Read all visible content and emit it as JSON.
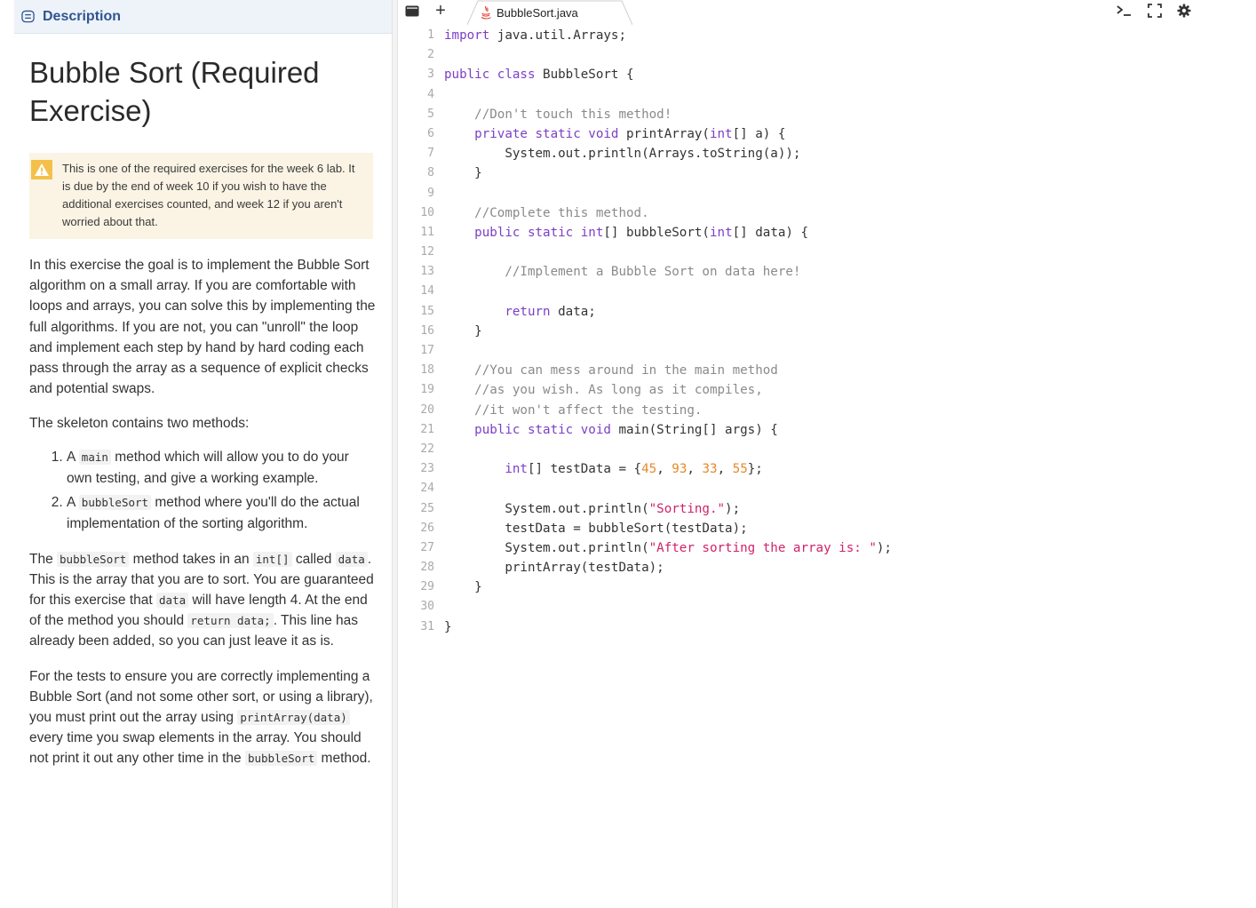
{
  "left": {
    "header_label": "Description",
    "title": "Bubble Sort (Required Exercise)",
    "warning": "This is one of the required exercises for the week 6 lab. It is due by the end of week 10 if you wish to have the additional exercises counted, and week 12 if you aren't worried about that.",
    "p1": "In this exercise the goal is to implement the Bubble Sort algorithm on a small array. If you are comfortable with loops and arrays, you can solve this by implementing the full algorithms. If you are not, you can \"unroll\" the loop and implement each step by hand by hard coding each pass through the array as a sequence of explicit checks and potential swaps.",
    "p2": "The skeleton contains two methods:",
    "list": [
      {
        "pre": "A ",
        "code": "main",
        "post": " method which will allow you to do your own testing, and give a working example."
      },
      {
        "pre": "A ",
        "code": "bubbleSort",
        "post": " method where you'll do the actual implementation of the sorting algorithm."
      }
    ],
    "p3": {
      "t1": "The ",
      "c1": "bubbleSort",
      "t2": " method takes in an ",
      "c2": "int[]",
      "t3": " called ",
      "c3": "data",
      "t4": ". This is the array that you are to sort. You are guaranteed for this exercise that ",
      "c4": "data",
      "t5": " will have length 4. At the end of the method you should ",
      "c5": "return data;",
      "t6": ". This line has already been added, so you can just leave it as is."
    },
    "p4": {
      "t1": "For the tests to ensure you are correctly implementing a Bubble Sort (and not some other sort, or using a library), you must print out the array using ",
      "c1": "printArray(data)",
      "t2": " every time you swap elements in the array. You should not print it out any other time in the ",
      "c2": "bubbleSort",
      "t3": " method."
    }
  },
  "editor": {
    "tab_add": "+",
    "file_tab": "BubbleSort.java",
    "icons": [
      "file-tree-icon",
      "add-icon",
      "java-file-icon",
      "terminal-icon",
      "fullscreen-icon",
      "gear-icon"
    ],
    "code_lines": [
      [
        [
          "kw",
          "import"
        ],
        [
          "p",
          " java.util.Arrays;"
        ]
      ],
      [],
      [
        [
          "kw",
          "public class"
        ],
        [
          "p",
          " BubbleSort {"
        ]
      ],
      [],
      [
        [
          "cm",
          "    //Don't touch this method!"
        ]
      ],
      [
        [
          "p",
          "    "
        ],
        [
          "kw",
          "private static void"
        ],
        [
          "p",
          " printArray("
        ],
        [
          "ty",
          "int"
        ],
        [
          "p",
          "[] a) {"
        ]
      ],
      [
        [
          "p",
          "        System.out.println(Arrays.toString(a));"
        ]
      ],
      [
        [
          "p",
          "    }"
        ]
      ],
      [],
      [
        [
          "cm",
          "    //Complete this method."
        ]
      ],
      [
        [
          "p",
          "    "
        ],
        [
          "kw",
          "public static"
        ],
        [
          "p",
          " "
        ],
        [
          "ty",
          "int"
        ],
        [
          "p",
          "[] bubbleSort("
        ],
        [
          "ty",
          "int"
        ],
        [
          "p",
          "[] data) {"
        ]
      ],
      [],
      [
        [
          "cm",
          "        //Implement a Bubble Sort on data here!"
        ]
      ],
      [],
      [
        [
          "p",
          "        "
        ],
        [
          "kw",
          "return"
        ],
        [
          "p",
          " data;"
        ]
      ],
      [
        [
          "p",
          "    }"
        ]
      ],
      [],
      [
        [
          "cm",
          "    //You can mess around in the main method"
        ]
      ],
      [
        [
          "cm",
          "    //as you wish. As long as it compiles,"
        ]
      ],
      [
        [
          "cm",
          "    //it won't affect the testing."
        ]
      ],
      [
        [
          "p",
          "    "
        ],
        [
          "kw",
          "public static void"
        ],
        [
          "p",
          " main(String[] args) {"
        ]
      ],
      [],
      [
        [
          "p",
          "        "
        ],
        [
          "ty",
          "int"
        ],
        [
          "p",
          "[] testData = {"
        ],
        [
          "nu",
          "45"
        ],
        [
          "p",
          ", "
        ],
        [
          "nu",
          "93"
        ],
        [
          "p",
          ", "
        ],
        [
          "nu",
          "33"
        ],
        [
          "p",
          ", "
        ],
        [
          "nu",
          "55"
        ],
        [
          "p",
          "};"
        ]
      ],
      [],
      [
        [
          "p",
          "        System.out.println("
        ],
        [
          "st",
          "\"Sorting.\""
        ],
        [
          "p",
          ");"
        ]
      ],
      [
        [
          "p",
          "        testData = bubbleSort(testData);"
        ]
      ],
      [
        [
          "p",
          "        System.out.println("
        ],
        [
          "st",
          "\"After sorting the array is: \""
        ],
        [
          "p",
          ");"
        ]
      ],
      [
        [
          "p",
          "        printArray(testData);"
        ]
      ],
      [
        [
          "p",
          "    }"
        ]
      ],
      [],
      [
        [
          "p",
          "}"
        ]
      ]
    ]
  }
}
